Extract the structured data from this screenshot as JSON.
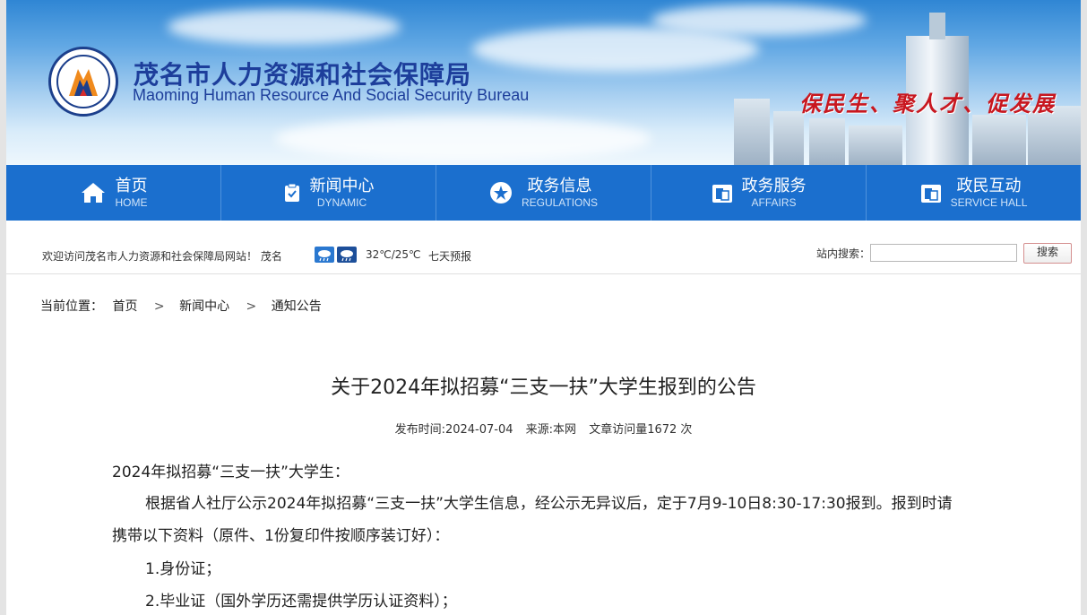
{
  "header": {
    "title_cn": "茂名市人力资源和社会保障局",
    "title_en": "Maoming Human Resource And Social Security Bureau",
    "slogan": "保民生、聚人才、促发展",
    "logo_ring_text": "茂名市人力资源和社会保障局"
  },
  "nav": [
    {
      "cn": "首页",
      "en": "HOME",
      "icon": "home-icon"
    },
    {
      "cn": "新闻中心",
      "en": "DYNAMIC",
      "icon": "clipboard-icon"
    },
    {
      "cn": "政务信息",
      "en": "REGULATIONS",
      "icon": "star-icon"
    },
    {
      "cn": "政务服务",
      "en": "AFFAIRS",
      "icon": "documents-icon"
    },
    {
      "cn": "政民互动",
      "en": "SERVICE HALL",
      "icon": "documents-icon"
    }
  ],
  "infobar": {
    "welcome": "欢迎访问茂名市人力资源和社会保障局网站！ 茂名",
    "temperature": "32℃/25℃",
    "forecast": "七天预报",
    "search_label": "站内搜索：",
    "search_value": "",
    "search_button": "搜索"
  },
  "breadcrumb": {
    "label": "当前位置：",
    "items": [
      "首页",
      "新闻中心",
      "通知公告"
    ],
    "separator": ">"
  },
  "article": {
    "title": "关于2024年拟招募“三支一扶”大学生报到的公告",
    "meta_date": "发布时间:2024-07-04",
    "meta_source": "来源:本网",
    "meta_views": "文章访问量1672 次",
    "salutation": "2024年拟招募“三支一扶”大学生：",
    "para1_line1": "根据省人社厅公示2024年拟招募“三支一扶”大学生信息，经公示无异议后，定于7月9-10日8:30-17:30报到。报到时请",
    "para1_line2": "携带以下资料（原件、1份复印件按顺序装订好）：",
    "item1": "1.身份证；",
    "item2": "2.毕业证（国外学历还需提供学历认证资料）；"
  },
  "colors": {
    "nav_bg": "#1b6fce",
    "title_blue": "#1d3e9b",
    "slogan_red": "#c8171f"
  }
}
